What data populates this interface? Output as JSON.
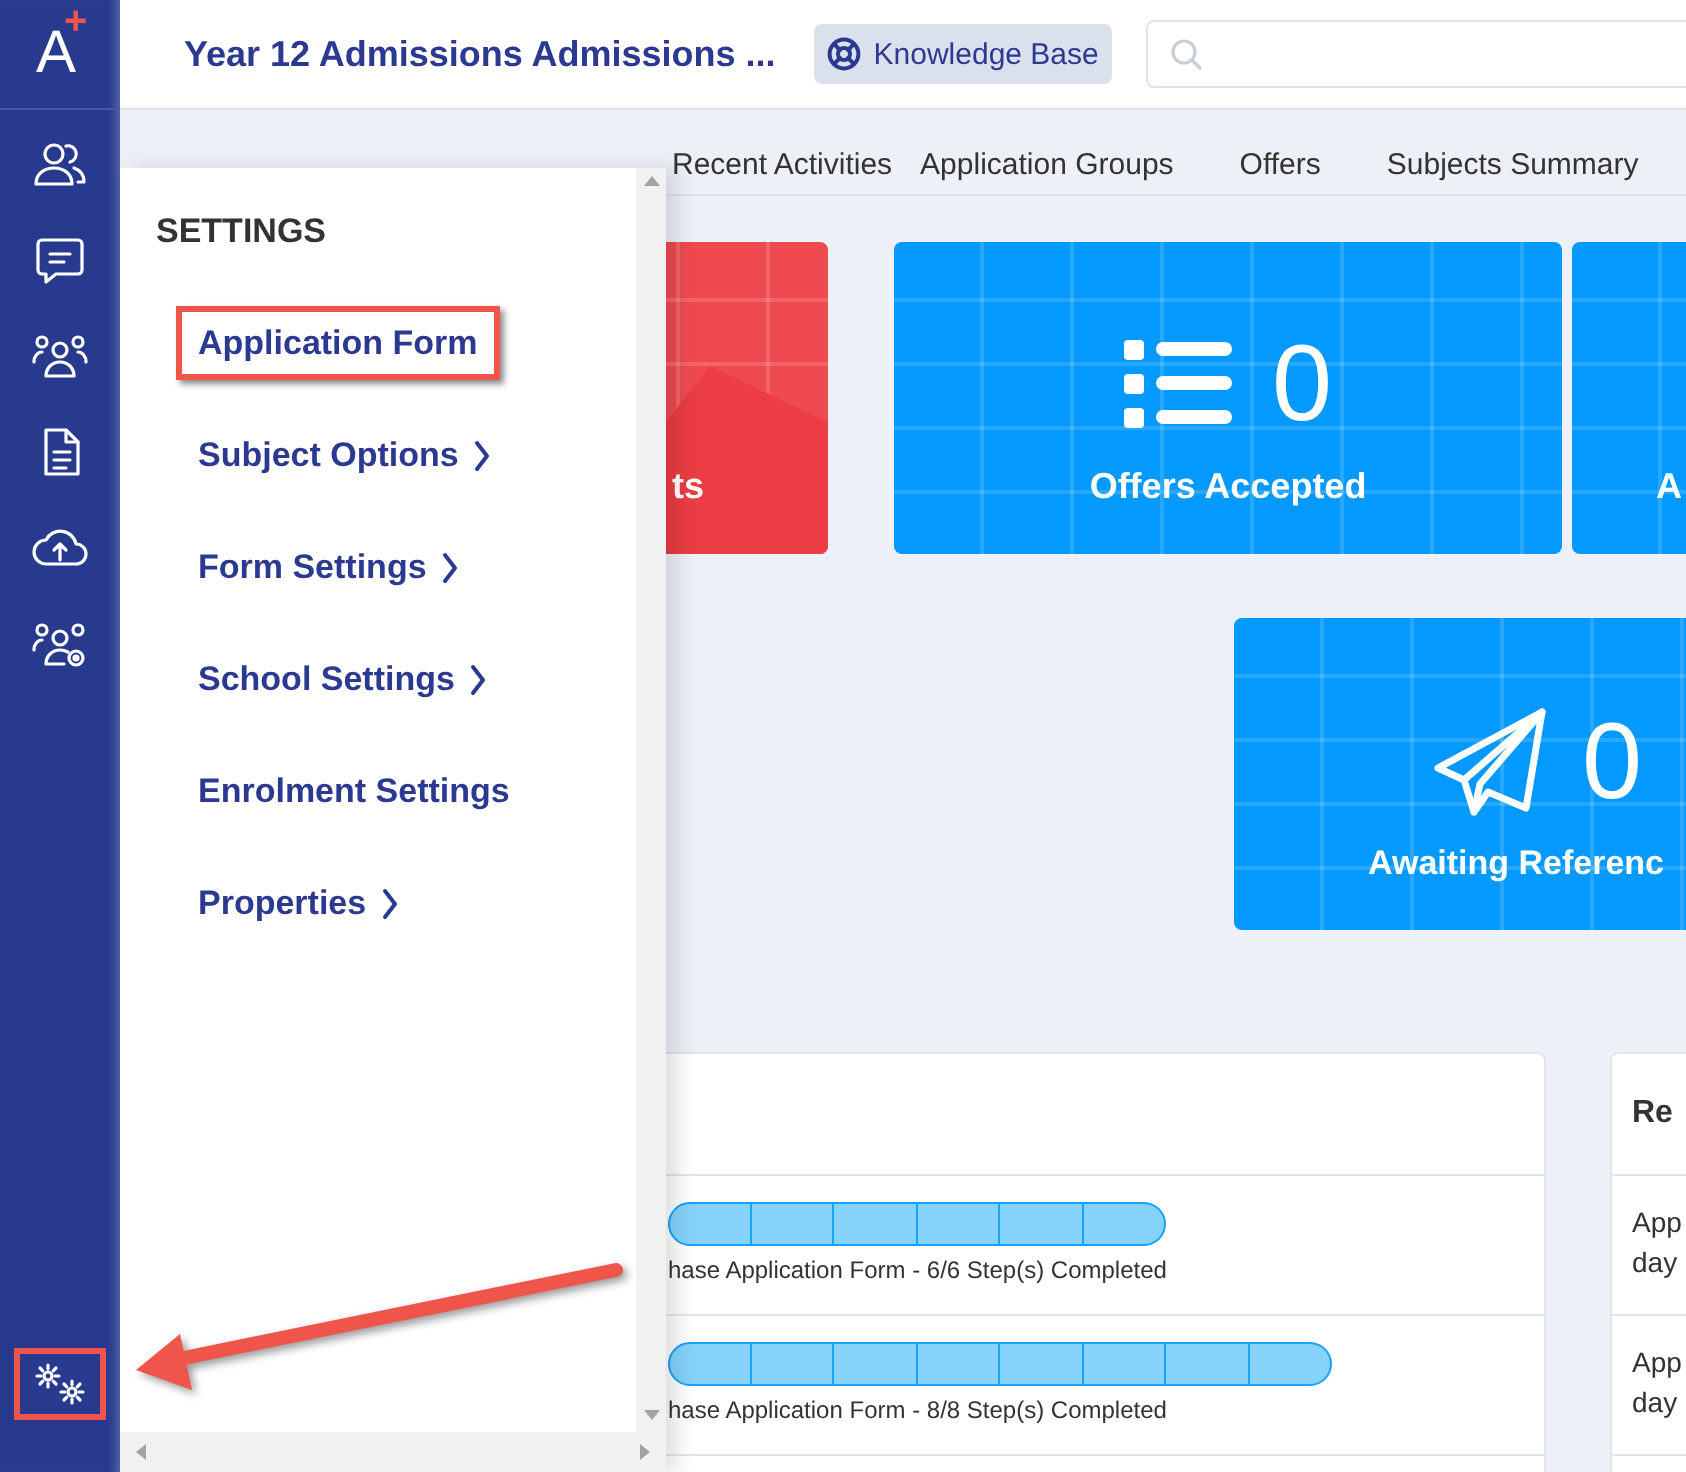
{
  "logo": {
    "letter": "A",
    "mark": "+"
  },
  "sidebar": {
    "items": [
      {
        "kind": "people",
        "highlighted": false
      },
      {
        "kind": "chat",
        "highlighted": false
      },
      {
        "kind": "group",
        "highlighted": false
      },
      {
        "kind": "document",
        "highlighted": false
      },
      {
        "kind": "upload",
        "highlighted": false
      },
      {
        "kind": "group-settings",
        "highlighted": false
      }
    ],
    "settings_button": {
      "highlighted": true
    }
  },
  "header": {
    "title": "Year 12 Admissions Admissions ...",
    "knowledge_base": "Knowledge Base"
  },
  "tabs": [
    {
      "label": "Recent Activities",
      "selected": false,
      "badge": false
    },
    {
      "label": "Application Groups",
      "selected": false,
      "badge": false
    },
    {
      "label": "Offers",
      "selected": false,
      "badge": false
    },
    {
      "label": "Subjects Summary",
      "selected": false,
      "badge": false
    }
  ],
  "card_rows": [
    [
      {
        "kind": "plain",
        "color": "#ef4a50",
        "label": "ts"
      },
      {
        "kind": "list",
        "color": "#0399ff",
        "value": "0",
        "label": "Offers Accepted"
      },
      {
        "kind": "plain",
        "color": "#0399ff",
        "label": "A"
      }
    ],
    [
      {
        "kind": "plane",
        "color": "#0399ff",
        "value": "0",
        "label": "Awaiting Referenc"
      }
    ]
  ],
  "progress_panel": {
    "rows": [
      {
        "steps": [
          {
            "done": true
          },
          {
            "done": true
          },
          {
            "done": true
          },
          {
            "done": true
          },
          {
            "done": true
          },
          {
            "done": true
          }
        ],
        "text": "hase Application Form - 6/6 Step(s) Completed"
      },
      {
        "steps": [
          {
            "done": true
          },
          {
            "done": true
          },
          {
            "done": true
          },
          {
            "done": true
          },
          {
            "done": true
          },
          {
            "done": true
          },
          {
            "done": true
          },
          {
            "done": true
          }
        ],
        "text": "hase Application Form - 8/8 Step(s) Completed"
      }
    ]
  },
  "side_panel": {
    "title": "Re",
    "rows": [
      {
        "line_1": "App",
        "line_2": "day"
      },
      {
        "line_1": "App",
        "line_2": "day"
      }
    ]
  },
  "settings_menu": {
    "title": "SETTINGS",
    "items": [
      {
        "label": "Application Form",
        "submenu": false,
        "highlighted": true
      },
      {
        "label": "Subject Options",
        "submenu": true,
        "highlighted": false
      },
      {
        "label": "Form Settings",
        "submenu": true,
        "highlighted": false
      },
      {
        "label": "School Settings",
        "submenu": true,
        "highlighted": false
      },
      {
        "label": "Enrolment Settings",
        "submenu": false,
        "highlighted": false
      },
      {
        "label": "Properties",
        "submenu": true,
        "highlighted": false
      }
    ]
  },
  "callout_arrow": true
}
